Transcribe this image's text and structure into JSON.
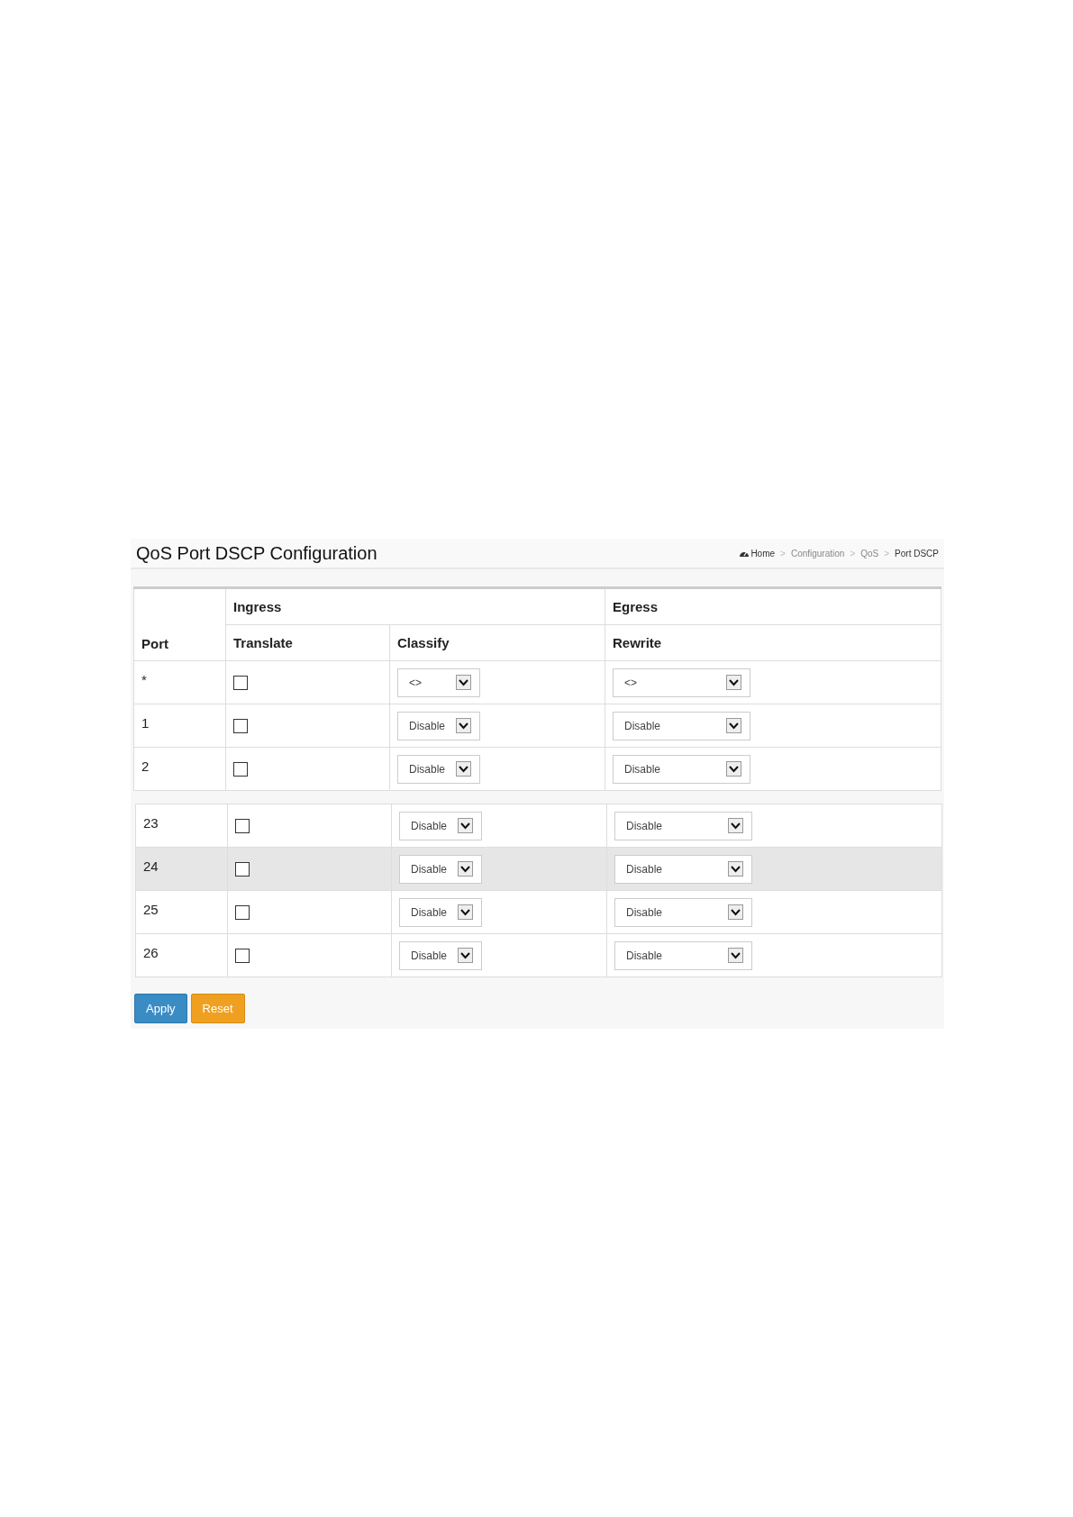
{
  "page_title": "QoS Port DSCP Configuration",
  "breadcrumb": [
    {
      "label": "Home",
      "current": false,
      "icon": true
    },
    {
      "label": ">",
      "kind": "separator"
    },
    {
      "label": "Configuration",
      "current": false
    },
    {
      "label": ">",
      "kind": "separator"
    },
    {
      "label": "QoS",
      "current": false
    },
    {
      "label": ">",
      "kind": "separator"
    },
    {
      "label": "Port DSCP",
      "current": true
    }
  ],
  "header": {
    "port": "Port",
    "ingress": "Ingress",
    "egress": "Egress",
    "translate": "Translate",
    "classify": "Classify",
    "rewrite": "Rewrite"
  },
  "tables": [
    {
      "rows": [
        {
          "port": "*",
          "translate_checked": false,
          "classify": "<>",
          "rewrite": "<>",
          "highlighted": false
        },
        {
          "port": "1",
          "translate_checked": false,
          "classify": "Disable",
          "rewrite": "Disable",
          "highlighted": false
        },
        {
          "port": "2",
          "translate_checked": false,
          "classify": "Disable",
          "rewrite": "Disable",
          "highlighted": false
        }
      ]
    },
    {
      "rows": [
        {
          "port": "23",
          "translate_checked": false,
          "classify": "Disable",
          "rewrite": "Disable",
          "highlighted": false
        },
        {
          "port": "24",
          "translate_checked": false,
          "classify": "Disable",
          "rewrite": "Disable",
          "highlighted": true
        },
        {
          "port": "25",
          "translate_checked": false,
          "classify": "Disable",
          "rewrite": "Disable",
          "highlighted": false
        },
        {
          "port": "26",
          "translate_checked": false,
          "classify": "Disable",
          "rewrite": "Disable",
          "highlighted": false
        }
      ]
    }
  ],
  "buttons": [
    {
      "label": "Apply",
      "kind": "primary"
    },
    {
      "label": "Reset",
      "kind": "warning"
    }
  ]
}
